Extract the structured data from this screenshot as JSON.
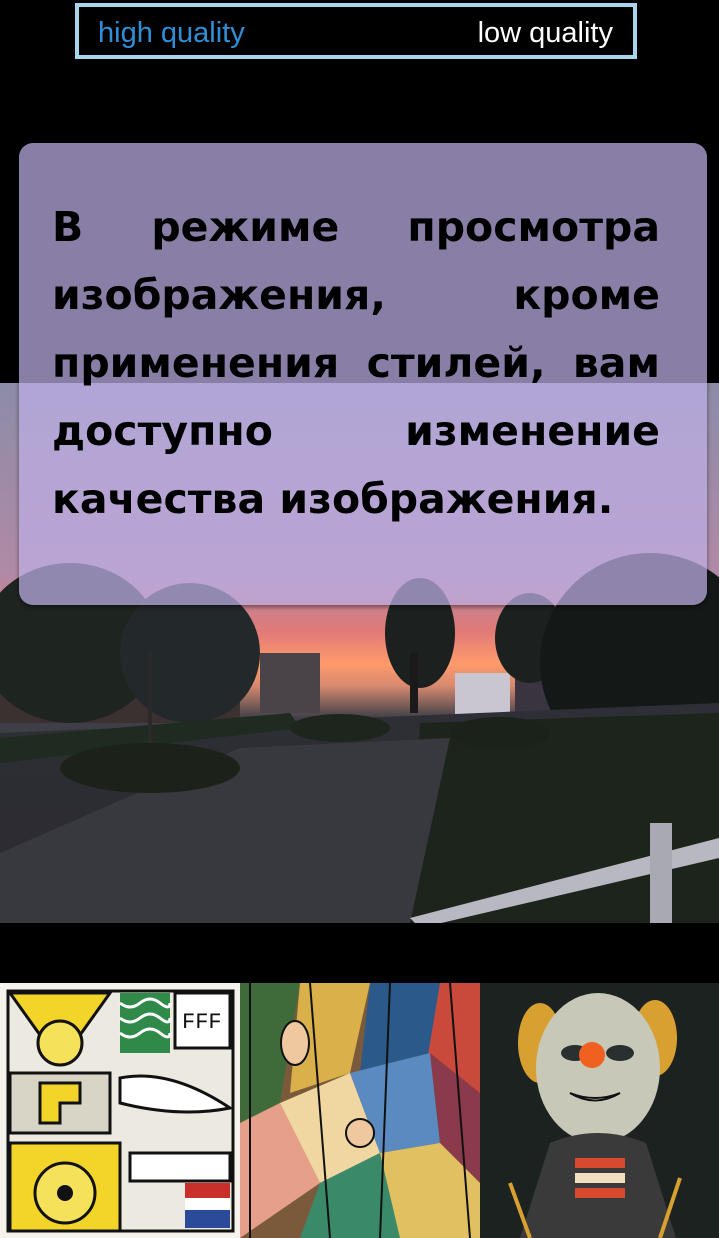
{
  "quality_toggle": {
    "high_label": "high quality",
    "low_label": "low quality",
    "selected": "high quality",
    "border_color": "#a9d6ec",
    "selected_color": "#2f8fd6"
  },
  "tip": {
    "text": "В режиме просмотра изображения, кроме применения стилей, вам доступно изменение качества изображения."
  },
  "style_thumbnails": [
    {
      "name": "style-thumbnail-1",
      "icon": "pop-art-painting"
    },
    {
      "name": "style-thumbnail-2",
      "icon": "cubist-painting"
    },
    {
      "name": "style-thumbnail-3",
      "icon": "clown-portrait-painting"
    }
  ]
}
